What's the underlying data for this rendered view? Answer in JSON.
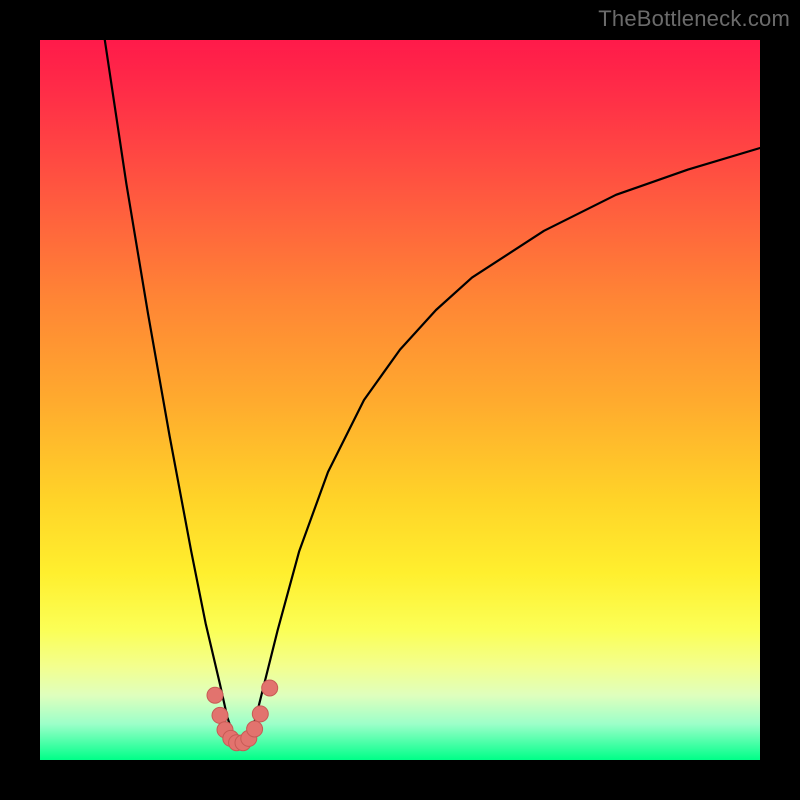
{
  "watermark": "TheBottleneck.com",
  "colors": {
    "frame": "#000000",
    "gradient_top": "#ff1a4a",
    "gradient_bottom": "#00ff88",
    "curve": "#000000",
    "beads": "#e2736e"
  },
  "chart_data": {
    "type": "line",
    "title": "",
    "xlabel": "",
    "ylabel": "",
    "xlim": [
      0,
      100
    ],
    "ylim": [
      0,
      100
    ],
    "grid": false,
    "legend": null,
    "note": "Axes have no tick labels in the image; values below are read from pixel positions and normalised to a 0–100 scale on each axis. The visible curve is a sharp V with minimum near x≈27, and a cluster of pink dots hugs the trough.",
    "series": [
      {
        "name": "curve",
        "x": [
          9.0,
          12.0,
          15.0,
          18.0,
          21.0,
          23.0,
          25.0,
          26.0,
          27.0,
          28.0,
          29.0,
          30.0,
          31.0,
          33.0,
          36.0,
          40.0,
          45.0,
          50.0,
          55.0,
          60.0,
          70.0,
          80.0,
          90.0,
          100.0
        ],
        "y": [
          100.0,
          80.0,
          62.0,
          45.0,
          29.0,
          19.0,
          10.5,
          6.0,
          3.0,
          2.0,
          3.0,
          6.0,
          10.0,
          18.0,
          29.0,
          40.0,
          50.0,
          57.0,
          62.5,
          67.0,
          73.5,
          78.5,
          82.0,
          85.0
        ]
      },
      {
        "name": "beads",
        "x": [
          24.3,
          25.0,
          25.7,
          26.5,
          27.3,
          28.2,
          29.0,
          29.8,
          30.6,
          31.9
        ],
        "y": [
          9.0,
          6.2,
          4.2,
          3.0,
          2.4,
          2.4,
          3.0,
          4.3,
          6.4,
          10.0
        ]
      }
    ]
  }
}
